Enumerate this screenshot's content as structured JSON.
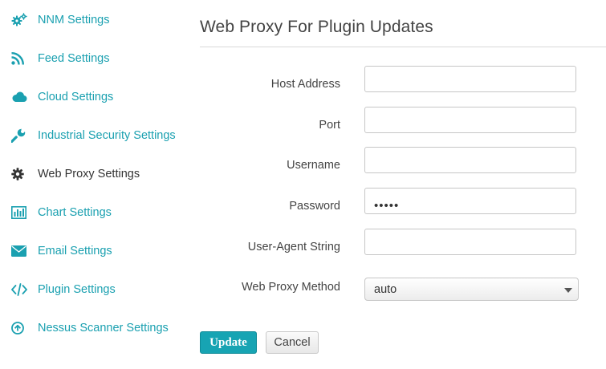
{
  "sidebar": {
    "items": [
      {
        "label": "NNM Settings",
        "icon": "gears-icon",
        "active": false
      },
      {
        "label": "Feed Settings",
        "icon": "rss-icon",
        "active": false
      },
      {
        "label": "Cloud Settings",
        "icon": "cloud-icon",
        "active": false
      },
      {
        "label": "Industrial Security Settings",
        "icon": "wrench-icon",
        "active": false
      },
      {
        "label": "Web Proxy Settings",
        "icon": "gear-icon",
        "active": true
      },
      {
        "label": "Chart Settings",
        "icon": "bar-chart-icon",
        "active": false
      },
      {
        "label": "Email Settings",
        "icon": "envelope-icon",
        "active": false
      },
      {
        "label": "Plugin Settings",
        "icon": "code-icon",
        "active": false
      },
      {
        "label": "Nessus Scanner Settings",
        "icon": "arrow-circle-up-icon",
        "active": false
      }
    ]
  },
  "colors": {
    "accent": "#1aa0b0",
    "active_text": "#333333",
    "button_primary": "#17a4b3"
  },
  "main": {
    "title": "Web Proxy For Plugin Updates",
    "form": {
      "host_address": {
        "label": "Host Address",
        "value": ""
      },
      "port": {
        "label": "Port",
        "value": ""
      },
      "username": {
        "label": "Username",
        "value": ""
      },
      "password": {
        "label": "Password",
        "masked_value": "•••••"
      },
      "user_agent": {
        "label": "User-Agent String",
        "value": ""
      },
      "proxy_method": {
        "label": "Web Proxy Method",
        "selected": "auto"
      }
    },
    "buttons": {
      "update": "Update",
      "cancel": "Cancel"
    }
  }
}
